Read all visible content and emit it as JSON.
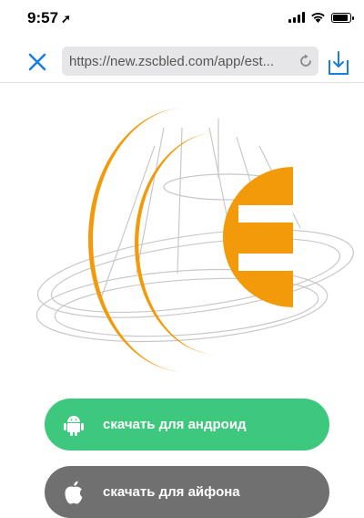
{
  "status_bar": {
    "time": "9:57",
    "location_icon": "location-arrow-icon",
    "icons": [
      "signal-icon",
      "wifi-icon",
      "battery-icon"
    ]
  },
  "browser": {
    "url": "https://new.zscbled.com/app/est...",
    "icons": [
      "close-icon",
      "reload-icon",
      "download-icon"
    ],
    "accent": "#1a7ee0"
  },
  "logo": {
    "primary_color": "#f39a0b",
    "line_color": "#c8c8c8"
  },
  "buttons": {
    "android": {
      "label": "скачать для андроид",
      "icon": "android-icon",
      "color": "#3ec87d"
    },
    "ios": {
      "label": "скачать для айфона",
      "icon": "apple-icon",
      "color": "#707070"
    }
  }
}
